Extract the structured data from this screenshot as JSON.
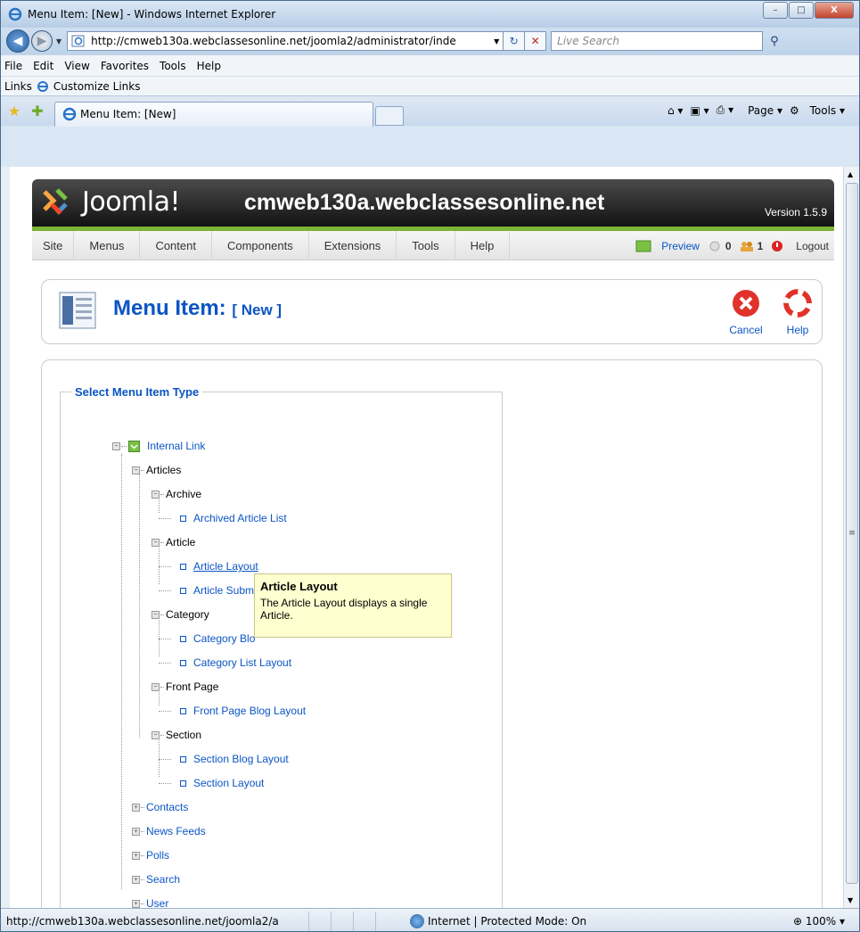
{
  "browser": {
    "window_title": "Menu Item: [New] - Windows Internet Explorer",
    "window_buttons": {
      "minimize": "–",
      "maximize": "□",
      "close": "X"
    },
    "address": "http://cmweb130a.webclassesonline.net/joomla2/administrator/inde",
    "search_placeholder": "Live Search",
    "menu": {
      "file": "File",
      "edit": "Edit",
      "view": "View",
      "favorites": "Favorites",
      "tools": "Tools",
      "help": "Help"
    },
    "links_label": "Links",
    "customize_links": "Customize Links",
    "tab_title": "Menu Item: [New]",
    "command_bar": {
      "page": "Page",
      "tools": "Tools"
    },
    "status_url": "http://cmweb130a.webclassesonline.net/joomla2/a",
    "zone": "Internet | Protected Mode: On",
    "zoom": "100%"
  },
  "joomla": {
    "brand": "Joomla!",
    "site_name": "cmweb130a.webclassesonline.net",
    "version": "Version 1.5.9",
    "menu": [
      "Site",
      "Menus",
      "Content",
      "Components",
      "Extensions",
      "Tools",
      "Help"
    ],
    "preview": "Preview",
    "messages_count": "0",
    "users_count": "1",
    "logout": "Logout",
    "page_title": "Menu Item:",
    "page_title_suffix": "[ New ]",
    "cancel": "Cancel",
    "help": "Help",
    "legend": "Select Menu Item Type",
    "tree": {
      "root": "Internal Link",
      "articles": "Articles",
      "archive": "Archive",
      "archived_article_list": "Archived Article List",
      "article": "Article",
      "article_layout": "Article Layout",
      "article_submission_layout": "Article Submi",
      "category": "Category",
      "category_blog_layout": "Category Blo",
      "category_list_layout": "Category List Layout",
      "front_page": "Front Page",
      "front_page_blog_layout": "Front Page Blog Layout",
      "section": "Section",
      "section_blog_layout": "Section Blog Layout",
      "section_layout": "Section Layout",
      "contacts": "Contacts",
      "news_feeds": "News Feeds",
      "polls": "Polls",
      "search": "Search",
      "user": "User"
    },
    "tooltip": {
      "title": "Article Layout",
      "text": "The Article Layout displays a single Article."
    }
  },
  "colors": {
    "link": "#0b55c4",
    "brand_green": "#7ab335",
    "header_dark": "#121212"
  }
}
